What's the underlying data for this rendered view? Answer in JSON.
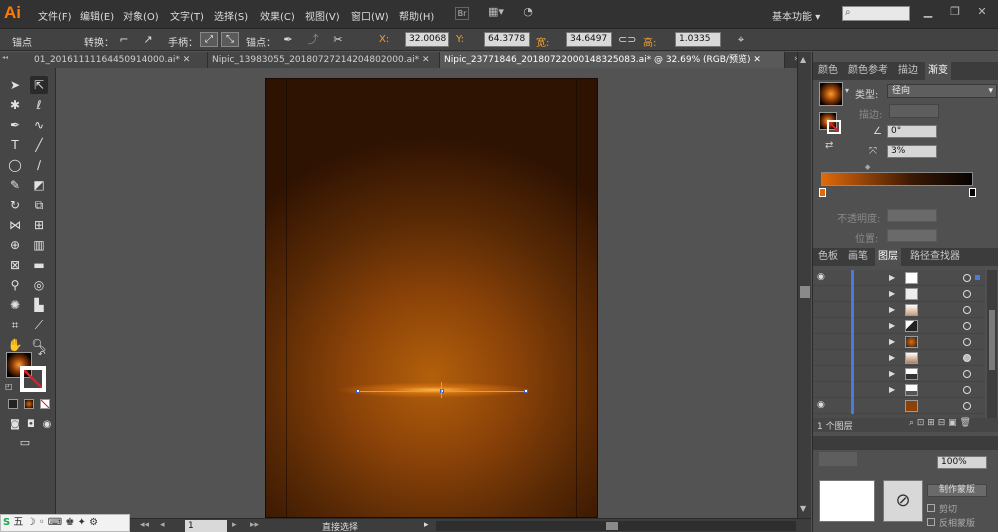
{
  "app": {
    "logo": "Ai",
    "workspace": "基本功能",
    "workspace_arrow": "▾"
  },
  "menu": [
    "文件(F)",
    "编辑(E)",
    "对象(O)",
    "文字(T)",
    "选择(S)",
    "效果(C)",
    "视图(V)",
    "窗口(W)",
    "帮助(H)"
  ],
  "control": {
    "anchor_label": "锚点",
    "convert_label": "转换：",
    "handle_label": "手柄：",
    "anchor2_label": "锚点：",
    "x_label": "X:",
    "x_value": "32.0068",
    "y_label": "Y:",
    "y_value": "64.3778",
    "w_label": "宽:",
    "w_value": "34.6497",
    "h_label": "高:",
    "h_value": "1.0335"
  },
  "tabs": [
    "01_20161111164450914000.ai*",
    "Nipic_13983055_20180727214204802000.ai*",
    "Nipic_23771846_20180722000148325083.ai* @ 32.69% (RGB/预览)"
  ],
  "gradient_panel": {
    "tabs": [
      "颜色",
      "颜色参考",
      "描边",
      "渐变"
    ],
    "active_tab": "渐变",
    "type_label": "类型:",
    "type_value": "径向",
    "stroke_label": "描边:",
    "angle_value": "0°",
    "ratio_value": "3%",
    "opacity_label": "不透明度:",
    "position_label": "位置:",
    "ramp_start": "#e06a0a",
    "ramp_end": "#050202"
  },
  "layers_panel": {
    "tabs": [
      "色板",
      "画笔",
      "图层",
      "路径查找器"
    ],
    "active_tab": "图层",
    "count_label": "1 个图层"
  },
  "transparency_panel": {
    "opacity_value": "100%",
    "make_mask_label": "制作蒙版",
    "clip_label": "剪切",
    "invert_label": "反相蒙版"
  },
  "status": {
    "zoom": "1",
    "tool_name": "直接选择"
  },
  "colors": {
    "accent_orange": "#ff7c00",
    "artboard_center": "#b3600b",
    "artboard_edge": "#2e1202"
  }
}
